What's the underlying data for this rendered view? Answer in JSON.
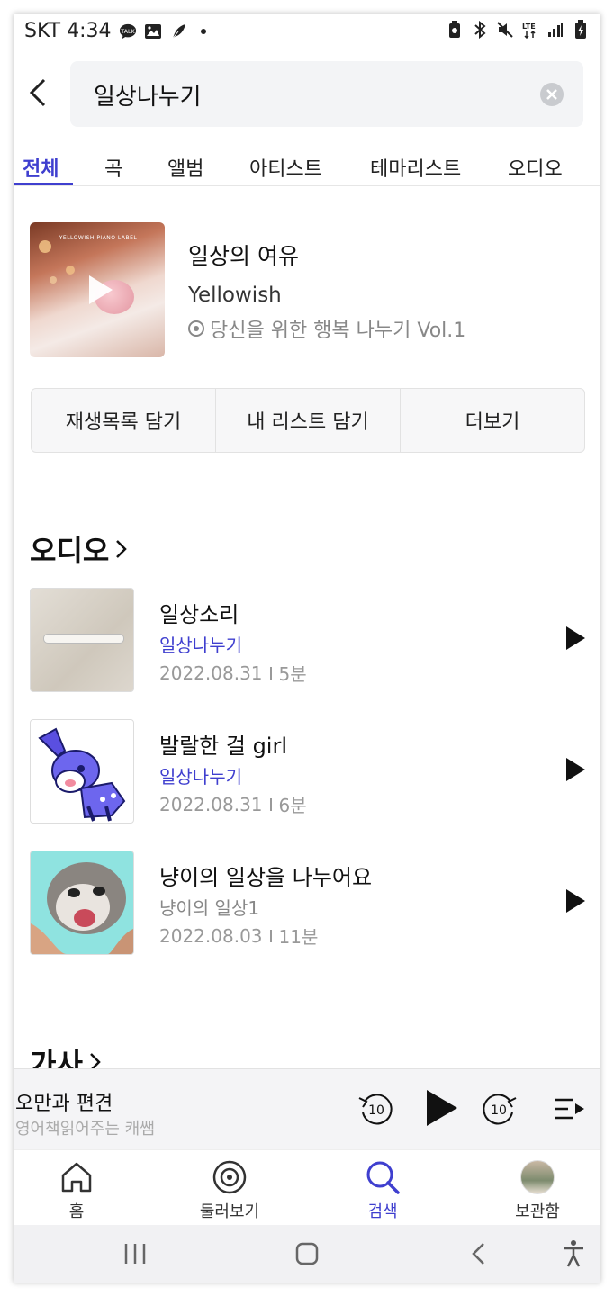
{
  "status_bar": {
    "carrier_time": "SKT 4:34",
    "icons_left": [
      "talk-icon",
      "gallery-icon",
      "feather-icon",
      "dot-icon"
    ],
    "icons_right": [
      "battery-saver-icon",
      "bluetooth-icon",
      "mute-icon",
      "lte-icon",
      "signal-icon",
      "battery-icon"
    ]
  },
  "search": {
    "query": "일상나누기"
  },
  "tabs": [
    {
      "label": "전체",
      "active": true
    },
    {
      "label": "곡"
    },
    {
      "label": "앨범"
    },
    {
      "label": "아티스트"
    },
    {
      "label": "테마리스트"
    },
    {
      "label": "오디오"
    }
  ],
  "top_result": {
    "title": "일상의 여유",
    "artist": "Yellowish",
    "album": "당신을 위한 행복 나누기 Vol.1",
    "cover_label": "YELLOWISH PIANO LABEL"
  },
  "actions": {
    "add_playlist": "재생목록 담기",
    "add_mylist": "내 리스트 담기",
    "more": "더보기"
  },
  "audio_section": {
    "title": "오디오",
    "items": [
      {
        "title": "일상소리",
        "channel": "일상나누기",
        "date": "2022.08.31",
        "duration": "5분"
      },
      {
        "title": "발랄한 걸 girl",
        "channel": "일상나누기",
        "date": "2022.08.31",
        "duration": "6분"
      },
      {
        "title": "냥이의 일상을 나누어요",
        "channel": "냥이의 일상1",
        "date": "2022.08.03",
        "duration": "11분"
      }
    ]
  },
  "lyrics_section": {
    "title": "가사"
  },
  "player": {
    "title": "오만과 편견",
    "artist": "영어책읽어주는 캐쌤",
    "rewind_label": "10",
    "forward_label": "10"
  },
  "bottom_nav": [
    {
      "label": "홈",
      "icon": "home-icon"
    },
    {
      "label": "둘러보기",
      "icon": "disc-icon"
    },
    {
      "label": "검색",
      "icon": "search-icon",
      "active": true
    },
    {
      "label": "보관함",
      "icon": "avatar"
    }
  ],
  "colors": {
    "accent": "#3f3fcf"
  }
}
